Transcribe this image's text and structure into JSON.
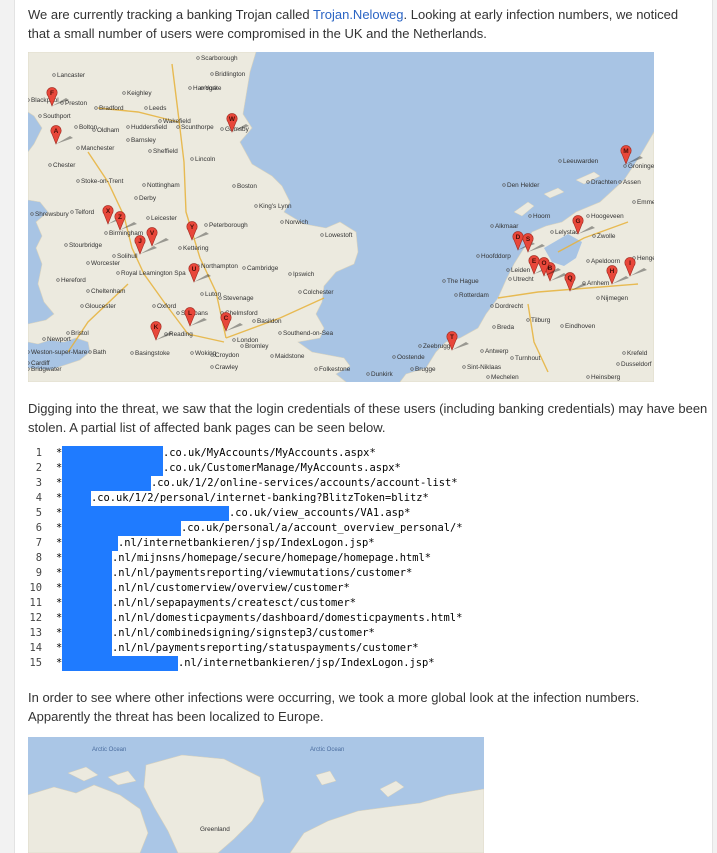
{
  "intro": {
    "before_link": "We are currently tracking a banking Trojan called ",
    "link_text": "Trojan.Neloweg",
    "after_link": ". Looking at early infection numbers, we noticed that a small number of users were compromised in the UK and the Netherlands."
  },
  "map_uk_nl": {
    "water_color": "#a8c4e4",
    "land_color": "#eceadf",
    "marker_color": "#e8473a",
    "places": [
      "Scarborough",
      "Bridlington",
      "Lancaster",
      "Harrogate",
      "York",
      "Preston",
      "Keighley",
      "Blackpool",
      "Bradford",
      "Leeds",
      "Southport",
      "Wakefield",
      "Bolton",
      "Oldham",
      "Huddersfield",
      "Scunthorpe",
      "Grimsby",
      "Barnsley",
      "Manchester",
      "Sheffield",
      "Lincoln",
      "Chester",
      "Stoke-on-Trent",
      "Nottingham",
      "Derby",
      "Boston",
      "Shrewsbury",
      "Telford",
      "Leicester",
      "King's Lynn",
      "Norwich",
      "Peterborough",
      "Stourbridge",
      "Birmingham",
      "Solihull",
      "Kettering",
      "Lowestoft",
      "Worcester",
      "Royal Leamington Spa",
      "Northampton",
      "Cambridge",
      "Ipswich",
      "Hereford",
      "Cheltenham",
      "Luton",
      "Stevenage",
      "Colchester",
      "Gloucester",
      "Oxford",
      "St Albans",
      "Chelmsford",
      "Basildon",
      "Newport",
      "Bristol",
      "Reading",
      "London",
      "Southend-on-Sea",
      "Cardiff",
      "Weston-super-Mare",
      "Bath",
      "Basingstoke",
      "Woking",
      "Croydon",
      "Bromley",
      "Maidstone",
      "Crawley",
      "Folkestone",
      "Bridgwater",
      "Dunkirk",
      "Leeuwarden",
      "Groningen",
      "Drachten",
      "Assen",
      "Den Helder",
      "Emmen",
      "Alkmaar",
      "Hoorn",
      "Hoogeveen",
      "Lelystad",
      "Zwolle",
      "Hengelo",
      "Apeldoorn",
      "Hoofddorp",
      "Leiden",
      "The Hague",
      "Utrecht",
      "Arnhem",
      "Rotterdam",
      "Dordrecht",
      "Nijmegen",
      "Tilburg",
      "Breda",
      "Eindhoven",
      "Krefeld",
      "Dusseldorf",
      "Zeebrugge",
      "Oostende",
      "Brugge",
      "Sint-Niklaas",
      "Antwerp",
      "Turnhout",
      "Mechelen",
      "Heinsberg"
    ],
    "marker_letters": [
      "A",
      "B",
      "C",
      "D",
      "E",
      "F",
      "G",
      "H",
      "I",
      "J",
      "K",
      "L",
      "M",
      "O",
      "Q",
      "S",
      "T",
      "U",
      "V",
      "W",
      "X",
      "Y",
      "Z"
    ]
  },
  "para2": "Digging into the threat, we saw that the login credentials of these users (including banking credentials) may have been stolen.  A partial list of affected bank pages can be seen below.",
  "code_lines": [
    {
      "n": "1",
      "star": "*",
      "path": ".co.uk/MyAccounts/MyAccounts.aspx*",
      "redact_w": 101
    },
    {
      "n": "2",
      "star": "*",
      "path": ".co.uk/CustomerManage/MyAccounts.aspx*",
      "redact_w": 101
    },
    {
      "n": "3",
      "star": "*",
      "path": ".co.uk/1/2/online-services/accounts/account-list*",
      "redact_w": 89
    },
    {
      "n": "4",
      "star": "*",
      "path": ".co.uk/1/2/personal/internet-banking?BlitzToken=blitz*",
      "redact_w": 29
    },
    {
      "n": "5",
      "star": "*",
      "path": ".co.uk/view_accounts/VA1.asp*",
      "redact_w": 167
    },
    {
      "n": "6",
      "star": "*",
      "path": ".co.uk/personal/a/account_overview_personal/*",
      "redact_w": 119
    },
    {
      "n": "7",
      "star": "*",
      "path": ".nl/internetbankieren/jsp/IndexLogon.jsp*",
      "redact_w": 56
    },
    {
      "n": "8",
      "star": "*",
      "path": ".nl/mijnsns/homepage/secure/homepage/homepage.html*",
      "redact_w": 50
    },
    {
      "n": "9",
      "star": "*",
      "path": ".nl/nl/paymentsreporting/viewmutations/customer*",
      "redact_w": 50
    },
    {
      "n": "10",
      "star": "*",
      "path": ".nl/nl/customerview/overview/customer*",
      "redact_w": 50
    },
    {
      "n": "11",
      "star": "*",
      "path": ".nl/nl/sepapayments/createsct/customer*",
      "redact_w": 50
    },
    {
      "n": "12",
      "star": "*",
      "path": ".nl/nl/domesticpayments/dashboard/domesticpayments.html*",
      "redact_w": 50
    },
    {
      "n": "13",
      "star": "*",
      "path": ".nl/nl/combinedsigning/signstep3/customer*",
      "redact_w": 50
    },
    {
      "n": "14",
      "star": "*",
      "path": ".nl/nl/paymentsreporting/statuspayments/customer*",
      "redact_w": 50
    },
    {
      "n": "15",
      "star": "*",
      "path": ".nl/internetbankieren/jsp/IndexLogon.jsp*",
      "redact_w": 116
    }
  ],
  "redaction_color": "#1f7bff",
  "para3": "In order to see where other infections were occurring, we took a more global look at the infection numbers. Apparently the threat has been localized to Europe.",
  "map_world": {
    "water_color": "#aac6e6",
    "land_color": "#eceadf",
    "labels": [
      "Arctic Ocean",
      "Arctic Ocean",
      "Greenland"
    ]
  }
}
